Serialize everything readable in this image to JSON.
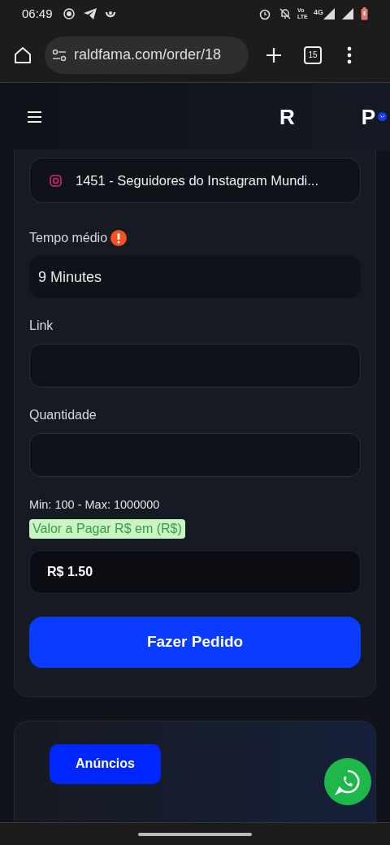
{
  "status_bar": {
    "time": "06:49",
    "network": "4G",
    "volte": "Vo LTE"
  },
  "browser": {
    "url": "raldfama.com/order/18",
    "tab_count": "15"
  },
  "header": {
    "logo": "R",
    "avatar": "P"
  },
  "form": {
    "service": "1451 - Seguidores do Instagram Mundi...",
    "fields": [
      {
        "label": "Tempo médio",
        "value": "9 Minutes",
        "kind": "info"
      },
      {
        "label": "Link",
        "kind": "input"
      },
      {
        "label": "Quantidade",
        "kind": "input"
      }
    ],
    "limits": "Min: 100 - Max: 1000000",
    "price_label": "Valor a Pagar R$ em (R$)",
    "price": "R$ 1.50",
    "submit": "Fazer Pedido"
  },
  "ads": {
    "button": "Anúncios"
  }
}
